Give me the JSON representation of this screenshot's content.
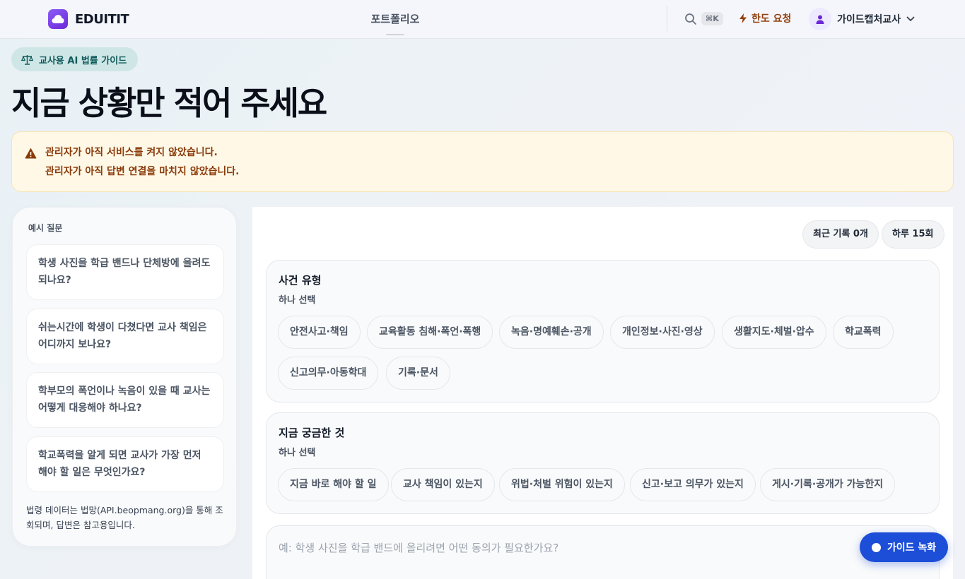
{
  "header": {
    "logo_text": "EDUITIT",
    "nav_portfolio": "포트폴리오",
    "shortcut": "⌘K",
    "quota_label": "한도 요청",
    "user_name": "가이드캡처교사"
  },
  "hero": {
    "badge": "교사용 AI 법률 가이드",
    "title": "지금 상황만 적어 주세요"
  },
  "alert": {
    "line1": "관리자가 아직 서비스를 켜지 않았습니다.",
    "line2": "관리자가 아직 답변 연결을 마치지 않았습니다."
  },
  "sidebar": {
    "label": "예시 질문",
    "questions": [
      "학생 사진을 학급 밴드나 단체방에 올려도 되나요?",
      "쉬는시간에 학생이 다쳤다면 교사 책임은 어디까지 보나요?",
      "학부모의 폭언이나 녹음이 있을 때 교사는 어떻게 대응해야 하나요?",
      "학교폭력을 알게 되면 교사가 가장 먼저 해야 할 일은 무엇인가요?"
    ],
    "footer": "법령 데이터는 법망(API.beopmang.org)을 통해 조회되며, 답변은 참고용입니다."
  },
  "main": {
    "recent_records": "최근 기록 0개",
    "daily_limit": "하루 15회",
    "incident": {
      "title": "사건 유형",
      "sub": "하나 선택",
      "options": [
        "안전사고·책임",
        "교육활동 침해·폭언·폭행",
        "녹음·명예훼손·공개",
        "개인정보·사진·영상",
        "생활지도·체벌·압수",
        "학교폭력",
        "신고의무·아동학대",
        "기록·문서"
      ]
    },
    "concern": {
      "title": "지금 궁금한 것",
      "sub": "하나 선택",
      "options": [
        "지금 바로 해야 할 일",
        "교사 책임이 있는지",
        "위법·처벌 위험이 있는지",
        "신고·보고 의무가 있는지",
        "게시·기록·공개가 가능한지"
      ]
    },
    "input_placeholder": "예: 학생 사진을 학급 밴드에 올리려면 어떤 동의가 필요한가요?"
  },
  "record_button": "가이드 녹화",
  "colors": {
    "accent": "#7c3aed",
    "alert_text": "#8a3b0b",
    "record_button": "#1d4ed8"
  }
}
